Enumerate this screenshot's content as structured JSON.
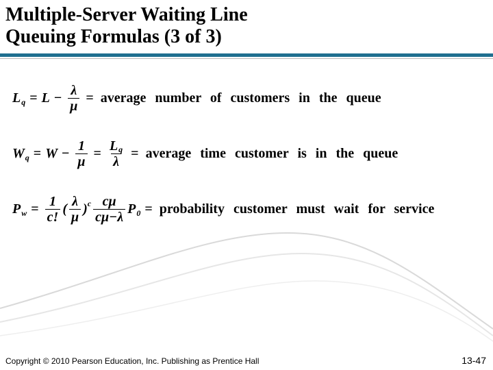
{
  "header": {
    "title_line1": "Multiple-Server Waiting Line",
    "title_line2": "Queuing Formulas (3 of 3)"
  },
  "formulas": {
    "f1": {
      "lhs_var": "L",
      "lhs_sub": "q",
      "rhs_var": "L",
      "frac_num": "λ",
      "frac_den": "μ",
      "desc": "average number of customers in the queue"
    },
    "f2": {
      "lhs_var": "W",
      "lhs_sub": "q",
      "rhs_var": "W",
      "minus_frac_num": "1",
      "minus_frac_den": "μ",
      "mid_frac_num_var": "L",
      "mid_frac_num_sub": "q",
      "mid_frac_den": "λ",
      "desc": "average time customer is in the queue"
    },
    "f3": {
      "lhs_var": "P",
      "lhs_sub": "w",
      "a_num": "1",
      "a_den": "c!",
      "b_num": "λ",
      "b_den": "μ",
      "b_sup": "c",
      "c_num": "cμ",
      "c_den": "cμ−λ",
      "tail_var": "P",
      "tail_sub": "0",
      "desc": "probability customer must wait for service"
    }
  },
  "footer": {
    "copyright": "Copyright © 2010 Pearson Education, Inc. Publishing as Prentice Hall",
    "page": "13-47"
  }
}
